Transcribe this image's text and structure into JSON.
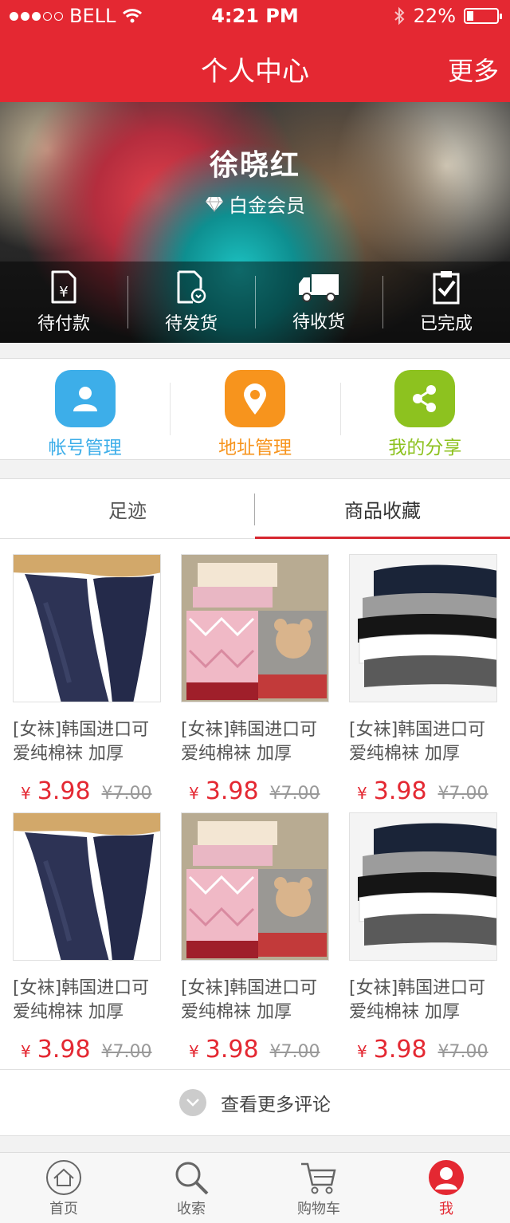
{
  "status_bar": {
    "carrier": "BELL",
    "time": "4:21 PM",
    "battery": "22%"
  },
  "header": {
    "title": "个人中心",
    "more": "更多"
  },
  "profile": {
    "name": "徐晓红",
    "member_level": "白金会员"
  },
  "orders": [
    {
      "label": "待付款",
      "icon": "payment-pending-icon"
    },
    {
      "label": "待发货",
      "icon": "awaiting-shipment-icon"
    },
    {
      "label": "待收货",
      "icon": "truck-icon"
    },
    {
      "label": "已完成",
      "icon": "clipboard-check-icon"
    }
  ],
  "quick_links": [
    {
      "label": "帐号管理",
      "icon": "user-icon",
      "color": "#3daee9"
    },
    {
      "label": "地址管理",
      "icon": "location-pin-icon",
      "color": "#f7941d"
    },
    {
      "label": "我的分享",
      "icon": "share-icon",
      "color": "#8dc21f"
    }
  ],
  "tabs": [
    {
      "label": "足迹",
      "active": false
    },
    {
      "label": "商品收藏",
      "active": true
    }
  ],
  "products": [
    {
      "name": "[女袜]韩国进口可爱纯棉袜 加厚",
      "currency": "¥",
      "price": "3.98",
      "old_price": "¥7.00",
      "image": "navy-tights"
    },
    {
      "name": "[女袜]韩国进口可爱纯棉袜 加厚",
      "currency": "¥",
      "price": "3.98",
      "old_price": "¥7.00",
      "image": "bear-socks"
    },
    {
      "name": "[女袜]韩国进口可爱纯棉袜 加厚",
      "currency": "¥",
      "price": "3.98",
      "old_price": "¥7.00",
      "image": "folded-socks"
    },
    {
      "name": "[女袜]韩国进口可爱纯棉袜 加厚",
      "currency": "¥",
      "price": "3.98",
      "old_price": "¥7.00",
      "image": "navy-tights"
    },
    {
      "name": "[女袜]韩国进口可爱纯棉袜 加厚",
      "currency": "¥",
      "price": "3.98",
      "old_price": "¥7.00",
      "image": "bear-socks"
    },
    {
      "name": "[女袜]韩国进口可爱纯棉袜 加厚",
      "currency": "¥",
      "price": "3.98",
      "old_price": "¥7.00",
      "image": "folded-socks"
    }
  ],
  "more_comments": "查看更多评论",
  "tabbar": [
    {
      "label": "首页",
      "icon": "home-icon",
      "active": false
    },
    {
      "label": "收索",
      "icon": "search-icon",
      "active": false
    },
    {
      "label": "购物车",
      "icon": "cart-icon",
      "active": false
    },
    {
      "label": "我",
      "icon": "profile-icon",
      "active": true
    }
  ],
  "colors": {
    "brand": "#e42832",
    "price": "#e42832",
    "account": "#3daee9",
    "address": "#f7941d",
    "share": "#8dc21f"
  }
}
